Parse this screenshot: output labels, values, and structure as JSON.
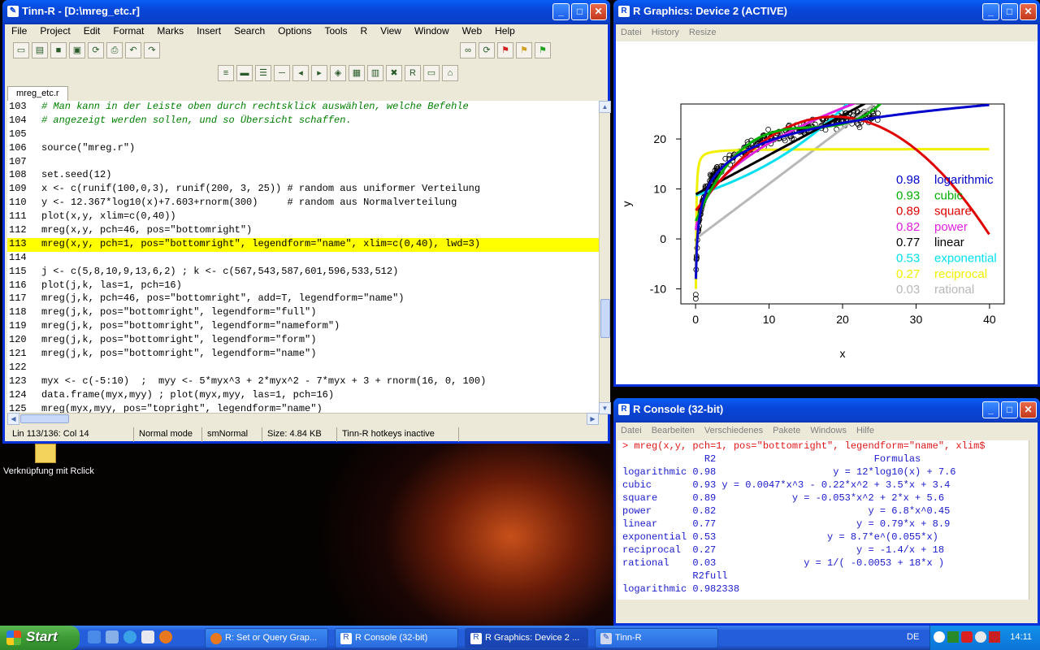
{
  "desktop": {
    "icon_label": "Verknüpfung mit Rclick"
  },
  "tinn": {
    "title": "Tinn-R - [D:\\mreg_etc.r]",
    "menu": [
      "File",
      "Project",
      "Edit",
      "Format",
      "Marks",
      "Insert",
      "Search",
      "Options",
      "Tools",
      "R",
      "View",
      "Window",
      "Web",
      "Help"
    ],
    "tab": "mreg_etc.r",
    "lines": [
      {
        "n": "103",
        "t": "# Man kann in der Leiste oben durch rechtsklick auswählen, welche Befehle",
        "k": "comment"
      },
      {
        "n": "104",
        "t": "# angezeigt werden sollen, und so Übersicht schaffen.",
        "k": "comment"
      },
      {
        "n": "105",
        "t": "",
        "k": ""
      },
      {
        "n": "106",
        "t": "source(\"mreg.r\")",
        "k": ""
      },
      {
        "n": "107",
        "t": "",
        "k": ""
      },
      {
        "n": "108",
        "t": "set.seed(12)",
        "k": ""
      },
      {
        "n": "109",
        "t": "x <- c(runif(100,0,3), runif(200, 3, 25)) # random aus uniformer Verteilung",
        "k": ""
      },
      {
        "n": "110",
        "t": "y <- 12.367*log10(x)+7.603+rnorm(300)     # random aus Normalverteilung",
        "k": ""
      },
      {
        "n": "111",
        "t": "plot(x,y, xlim=c(0,40))",
        "k": ""
      },
      {
        "n": "112",
        "t": "mreg(x,y, pch=46, pos=\"bottomright\")",
        "k": ""
      },
      {
        "n": "113",
        "t": "mreg(x,y, pch=1, pos=\"bottomright\", legendform=\"name\", xlim=c(0,40), lwd=3)",
        "k": "hl"
      },
      {
        "n": "114",
        "t": "",
        "k": ""
      },
      {
        "n": "115",
        "t": "j <- c(5,8,10,9,13,6,2) ; k <- c(567,543,587,601,596,533,512)",
        "k": ""
      },
      {
        "n": "116",
        "t": "plot(j,k, las=1, pch=16)",
        "k": ""
      },
      {
        "n": "117",
        "t": "mreg(j,k, pch=46, pos=\"bottomright\", add=T, legendform=\"name\")",
        "k": ""
      },
      {
        "n": "118",
        "t": "mreg(j,k, pos=\"bottomright\", legendform=\"full\")",
        "k": ""
      },
      {
        "n": "119",
        "t": "mreg(j,k, pos=\"bottomright\", legendform=\"nameform\")",
        "k": ""
      },
      {
        "n": "120",
        "t": "mreg(j,k, pos=\"bottomright\", legendform=\"form\")",
        "k": ""
      },
      {
        "n": "121",
        "t": "mreg(j,k, pos=\"bottomright\", legendform=\"name\")",
        "k": ""
      },
      {
        "n": "122",
        "t": "",
        "k": ""
      },
      {
        "n": "123",
        "t": "myx <- c(-5:10)  ;  myy <- 5*myx^3 + 2*myx^2 - 7*myx + 3 + rnorm(16, 0, 100)",
        "k": ""
      },
      {
        "n": "124",
        "t": "data.frame(myx,myy) ; plot(myx,myy, las=1, pch=16)",
        "k": ""
      },
      {
        "n": "125",
        "t": "mreg(myx,myy, pos=\"topright\", legendform=\"name\")",
        "k": ""
      }
    ],
    "status": [
      "Lin 113/136: Col 14",
      "Normal mode",
      "smNormal",
      "Size: 4.84 KB",
      "Tinn-R hotkeys inactive"
    ]
  },
  "graphics": {
    "title": "R Graphics: Device 2 (ACTIVE)",
    "menu": [
      "Datei",
      "History",
      "Resize"
    ]
  },
  "chart_data": {
    "type": "line",
    "xlabel": "x",
    "ylabel": "y",
    "xlim": [
      -2,
      42
    ],
    "ylim": [
      -13,
      27
    ],
    "xticks": [
      0,
      10,
      20,
      30,
      40
    ],
    "yticks": [
      -10,
      0,
      10,
      20
    ],
    "legend_position": "bottom-right",
    "series": [
      {
        "name": "logarithmic",
        "r2": "0.98",
        "color": "#0000cc"
      },
      {
        "name": "cubic",
        "r2": "0.93",
        "color": "#00b000"
      },
      {
        "name": "square",
        "r2": "0.89",
        "color": "#e00000"
      },
      {
        "name": "power",
        "r2": "0.82",
        "color": "#e020e0"
      },
      {
        "name": "linear",
        "r2": "0.77",
        "color": "#000000"
      },
      {
        "name": "exponential",
        "r2": "0.53",
        "color": "#00e0f0"
      },
      {
        "name": "reciprocal",
        "r2": "0.27",
        "color": "#f0f000"
      },
      {
        "name": "rational",
        "r2": "0.03",
        "color": "#b8b8b8"
      }
    ]
  },
  "rconsole": {
    "title": "R Console (32-bit)",
    "menu": [
      "Datei",
      "Bearbeiten",
      "Verschiedenes",
      "Pakete",
      "Windows",
      "Hilfe"
    ],
    "lines": [
      {
        "t": "> mreg(x,y, pch=1, pos=\"bottomright\", legendform=\"name\", xlim$",
        "red": true
      },
      {
        "t": "              R2                           Formulas",
        "red": false
      },
      {
        "t": "logarithmic 0.98                    y = 12*log10(x) + 7.6",
        "red": false
      },
      {
        "t": "cubic       0.93 y = 0.0047*x^3 - 0.22*x^2 + 3.5*x + 3.4",
        "red": false
      },
      {
        "t": "square      0.89             y = -0.053*x^2 + 2*x + 5.6",
        "red": false
      },
      {
        "t": "power       0.82                          y = 6.8*x^0.45",
        "red": false
      },
      {
        "t": "linear      0.77                        y = 0.79*x + 8.9",
        "red": false
      },
      {
        "t": "exponential 0.53                   y = 8.7*e^(0.055*x)",
        "red": false
      },
      {
        "t": "reciprocal  0.27                        y = -1.4/x + 18",
        "red": false
      },
      {
        "t": "rational    0.03               y = 1/( -0.0053 + 18*x )",
        "red": false
      },
      {
        "t": "            R2full",
        "red": false
      },
      {
        "t": "logarithmic 0.982338",
        "red": false
      }
    ]
  },
  "taskbar": {
    "start": "Start",
    "tasks": [
      "R: Set or Query Grap...",
      "R Console (32-bit)",
      "R Graphics: Device 2 ...",
      "Tinn-R"
    ],
    "lang": "DE",
    "clock": "14:11"
  }
}
